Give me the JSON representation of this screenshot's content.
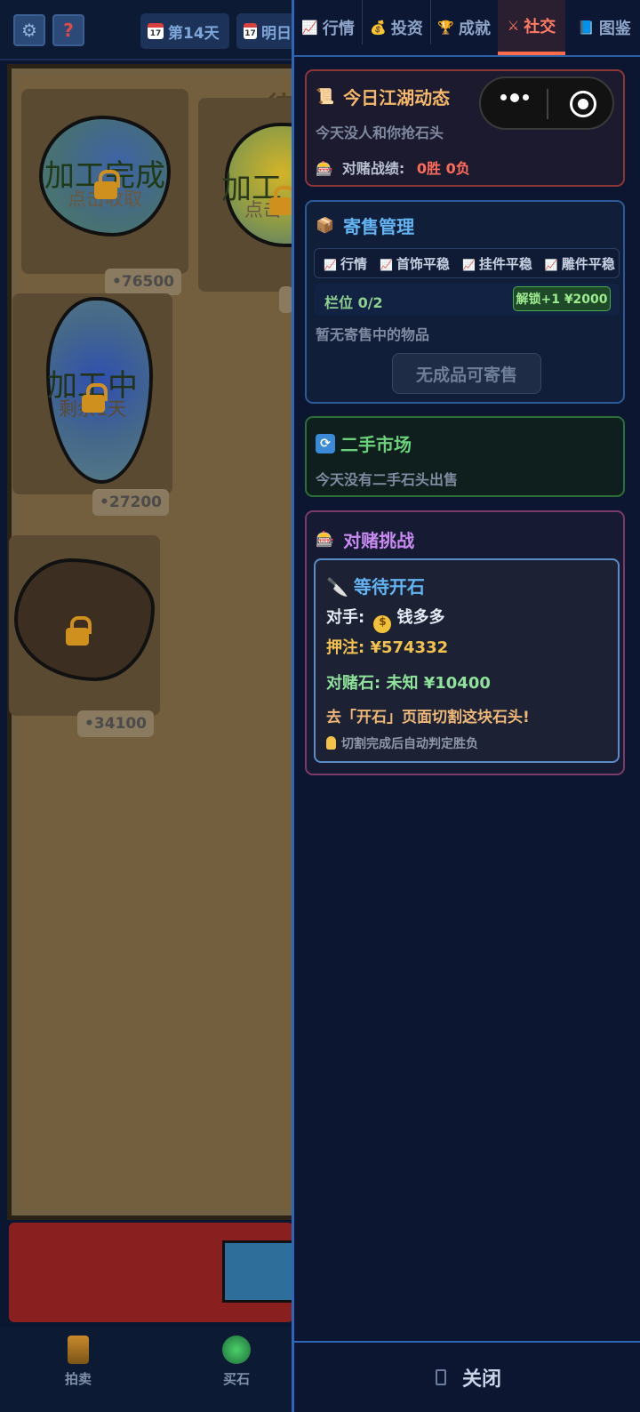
{
  "topbar": {
    "day_label": "第14天",
    "next_day_label": "明日",
    "calendar_num": "17"
  },
  "board": {
    "heading": "待",
    "stones": [
      {
        "status": "加工完成",
        "sub": "点击收取",
        "price": "76500"
      },
      {
        "status": "加工",
        "sub": "点击",
        "price": ""
      },
      {
        "status": "加工中",
        "sub": "剩余1天",
        "price": "27200"
      },
      {
        "status": "",
        "sub": "",
        "price": "34100"
      }
    ]
  },
  "bottom_nav": {
    "auction": "拍卖",
    "buy_stone": "买石"
  },
  "tabs": [
    {
      "icon": "📈",
      "label": "行情"
    },
    {
      "icon": "💰",
      "label": "投资"
    },
    {
      "icon": "🏆",
      "label": "成就"
    },
    {
      "icon": "⚔",
      "label": "社交"
    },
    {
      "icon": "📘",
      "label": "图鉴"
    }
  ],
  "active_tab": "社交",
  "jianghu": {
    "title": "今日江湖动态",
    "message": "今天没人和你抢石头",
    "record_label": "对赌战绩:",
    "record_value": "0胜 0负"
  },
  "consign": {
    "title": "寄售管理",
    "chips": [
      "行情",
      "首饰平稳",
      "挂件平稳",
      "雕件平稳"
    ],
    "slot_label": "栏位 0/2",
    "unlock_label": "解锁+1 ¥2000",
    "empty_text": "暂无寄售中的物品",
    "sell_button": "无成品可寄售"
  },
  "market": {
    "title": "二手市场",
    "empty_text": "今天没有二手石头出售"
  },
  "challenge": {
    "title": "对赌挑战",
    "status": "等待开石",
    "opponent_label": "对手:",
    "opponent_name": "钱多多",
    "stake": "押注: ¥574332",
    "stone": "对赌石: 未知 ¥10400",
    "instruction": "去「开石」页面切割这块石头!",
    "tip": "切割完成后自动判定胜负"
  },
  "close_label": "关闭",
  "colors": {
    "accent_orange": "#ff7b63",
    "title_gold": "#f5b86a",
    "title_blue": "#63b4f2",
    "title_green": "#6bd17a",
    "title_purple": "#c78bf0",
    "record_red": "#ff6b5a",
    "stake_gold": "#f2c14e",
    "stone_green": "#8fe19b"
  }
}
